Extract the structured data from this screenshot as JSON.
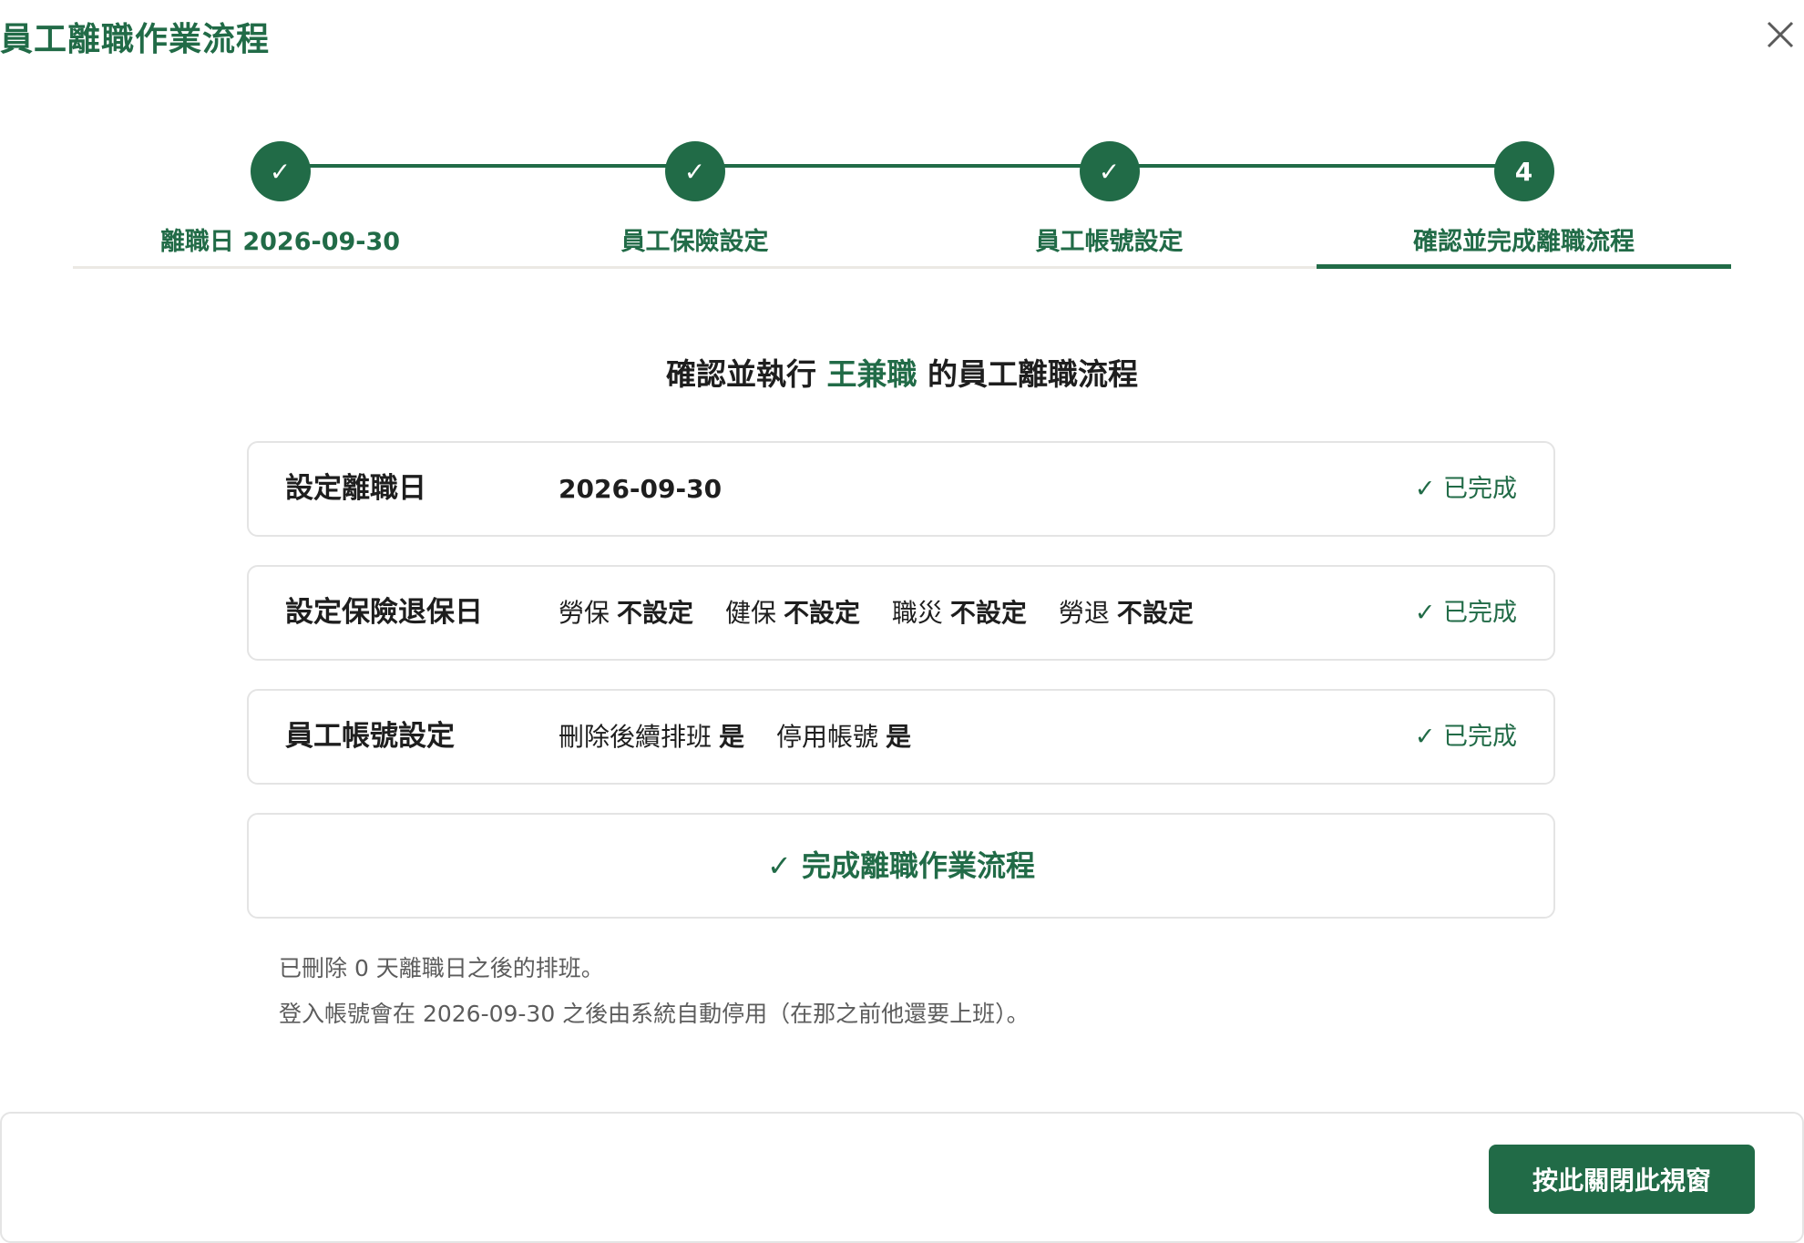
{
  "dialog": {
    "title": "員工離職作業流程",
    "close_icon": "close-icon"
  },
  "stepper": {
    "steps": [
      {
        "marker": "✓",
        "label": "離職日 2026-09-30",
        "state": "completed"
      },
      {
        "marker": "✓",
        "label": "員工保險設定",
        "state": "completed"
      },
      {
        "marker": "✓",
        "label": "員工帳號設定",
        "state": "completed"
      },
      {
        "marker": "4",
        "label": "確認並完成離職流程",
        "state": "active"
      }
    ]
  },
  "confirm": {
    "prefix": "確認並執行",
    "employee_name": "王兼職",
    "suffix": "的員工離職流程"
  },
  "cards": {
    "resign_date": {
      "title": "設定離職日",
      "value": "2026-09-30",
      "status": "✓ 已完成"
    },
    "insurance": {
      "title": "設定保險退保日",
      "items": [
        {
          "name": "勞保",
          "value": "不設定"
        },
        {
          "name": "健保",
          "value": "不設定"
        },
        {
          "name": "職災",
          "value": "不設定"
        },
        {
          "name": "勞退",
          "value": "不設定"
        }
      ],
      "status": "✓ 已完成"
    },
    "account": {
      "title": "員工帳號設定",
      "items": [
        {
          "name": "刪除後續排班",
          "value": "是"
        },
        {
          "name": "停用帳號",
          "value": "是"
        }
      ],
      "status": "✓ 已完成"
    }
  },
  "finish_label": "✓ 完成離職作業流程",
  "notes": [
    "已刪除 0 天離職日之後的排班。",
    "登入帳號會在 2026-09-30 之後由系統自動停用（在那之前他還要上班）。"
  ],
  "footer": {
    "close_window_label": "按此關閉此視窗"
  },
  "colors": {
    "brand": "#216b47",
    "text": "#1e1e1e",
    "muted": "#5c5c5c",
    "border": "#e4e4e4"
  }
}
